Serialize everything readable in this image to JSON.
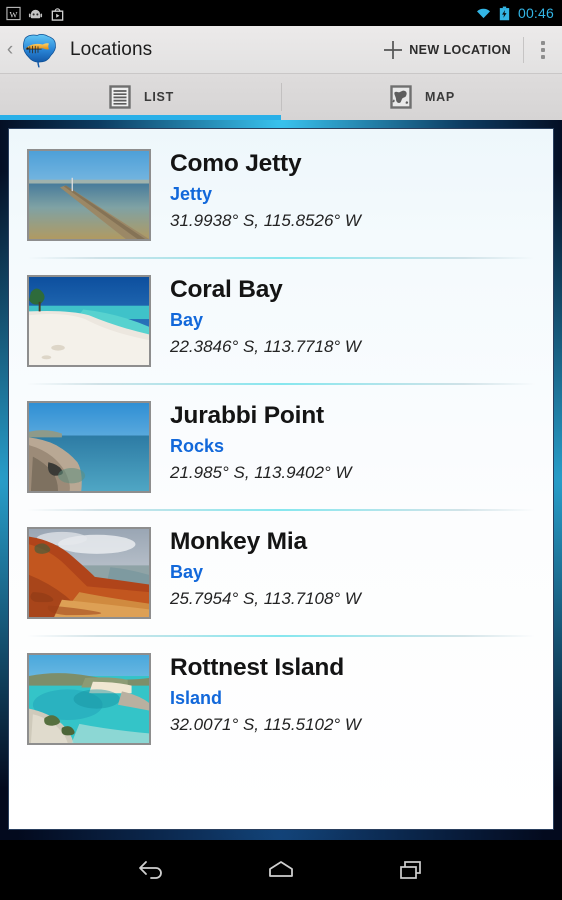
{
  "statusbar": {
    "icons": [
      "wikipedia-icon",
      "android-bot-icon",
      "play-store-icon"
    ],
    "wifi_icon": "wifi-icon",
    "battery_icon": "battery-charging-icon",
    "time": "00:46",
    "time_color": "#33b5e5"
  },
  "actionbar": {
    "up_caret": "‹",
    "logo": "app-logo-australia-fish",
    "title": "Locations",
    "new_location_label": "NEW LOCATION",
    "overflow": "overflow-menu-icon"
  },
  "tabs": [
    {
      "label": "LIST",
      "icon": "list-icon",
      "active": true
    },
    {
      "label": "MAP",
      "icon": "map-icon",
      "active": false
    }
  ],
  "accent": {
    "tab_indicator": "#29b0e8",
    "type_blue": "#1268da",
    "frame_glow": "#3ccdfa"
  },
  "locations": [
    {
      "name": "Como Jetty",
      "type": "Jetty",
      "coords": "31.9938° S, 115.8526° W",
      "thumb": "jetty-photo"
    },
    {
      "name": "Coral Bay",
      "type": "Bay",
      "coords": "22.3846° S, 113.7718° W",
      "thumb": "white-beach-photo"
    },
    {
      "name": "Jurabbi Point",
      "type": "Rocks",
      "coords": "21.985° S, 113.9402° W",
      "thumb": "rocky-shore-photo"
    },
    {
      "name": "Monkey Mia",
      "type": "Bay",
      "coords": "25.7954° S, 113.7108° W",
      "thumb": "red-cliff-beach-photo"
    },
    {
      "name": "Rottnest Island",
      "type": "Island",
      "coords": "32.0071° S, 115.5102° W",
      "thumb": "turquoise-bay-photo"
    }
  ],
  "navbar": {
    "back": "back-icon",
    "home": "home-icon",
    "recents": "recents-icon"
  }
}
